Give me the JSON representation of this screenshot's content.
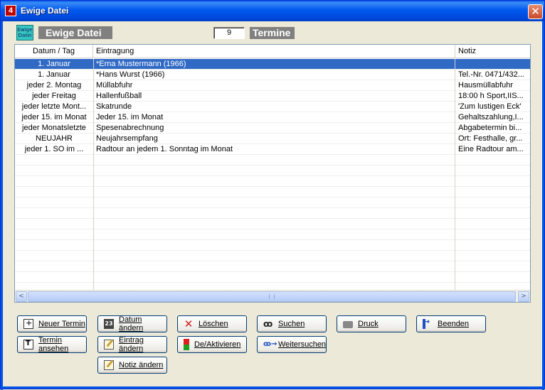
{
  "window": {
    "title": "Ewige Datei",
    "close_label": "✕"
  },
  "header": {
    "icon_text": "Ewige Datei",
    "label": "Ewige Datei",
    "count": "9",
    "count_label": "Termine"
  },
  "list": {
    "columns": [
      "Datum / Tag",
      "Eintragung",
      "Notiz"
    ],
    "rows": [
      {
        "datum": "1. Januar",
        "eintragung": "*Erna Mustermann (1966)",
        "notiz": "",
        "selected": true
      },
      {
        "datum": "1. Januar",
        "eintragung": "*Hans Wurst (1966)",
        "notiz": "Tel.-Nr. 0471/432..."
      },
      {
        "datum": "jeder 2. Montag",
        "eintragung": "Müllabfuhr",
        "notiz": "Hausmüllabfuhr"
      },
      {
        "datum": "jeder Freitag",
        "eintragung": "Hallenfußball",
        "notiz": "18:00 h Sport,IIS..."
      },
      {
        "datum": "jeder letzte Mont...",
        "eintragung": "Skatrunde",
        "notiz": "'Zum lustigen Eck'"
      },
      {
        "datum": "jeder 15. im Monat",
        "eintragung": "Jeder 15. im Monat",
        "notiz": "Gehaltszahlung,I..."
      },
      {
        "datum": "jeder Monatsletzte",
        "eintragung": "Spesenabrechnung",
        "notiz": "Abgabetermin bi..."
      },
      {
        "datum": "NEUJAHR",
        "eintragung": "Neujahrsempfang",
        "notiz": "Ort: Festhalle, gr..."
      },
      {
        "datum": "jeder 1. SO im ...",
        "eintragung": "Radtour an jedem 1. Sonntag im Monat",
        "notiz": "Eine Radtour am..."
      }
    ],
    "empty_rows": 12
  },
  "scrollbar": {
    "left": "<",
    "right": ">"
  },
  "buttons": {
    "neuer_termin": {
      "label": "Neuer Termin",
      "icon": "new-appointment-icon"
    },
    "datum_aendern": {
      "label": "Datum ändern",
      "icon": "date-icon"
    },
    "loeschen": {
      "label": "Löschen",
      "icon": "delete-icon"
    },
    "suchen": {
      "label": "Suchen",
      "icon": "binoculars-icon"
    },
    "druck": {
      "label": "Druck",
      "icon": "printer-icon"
    },
    "beenden": {
      "label": "Beenden",
      "icon": "exit-icon"
    },
    "termin_ansehen": {
      "label": "Termin ansehen",
      "icon": "view-icon"
    },
    "eintrag_aendern": {
      "label": "Eintrag ändern",
      "icon": "edit-icon"
    },
    "de_aktivieren": {
      "label": "De/Aktivieren",
      "icon": "toggle-icon"
    },
    "weitersuchen": {
      "label": "Weitersuchen",
      "icon": "find-next-icon"
    },
    "notiz_aendern": {
      "label": "Notiz ändern",
      "icon": "note-edit-icon"
    }
  },
  "colors": {
    "selection": "#316AC5",
    "titlebar": "#0058EE",
    "window_bg": "#ECE9D8"
  }
}
